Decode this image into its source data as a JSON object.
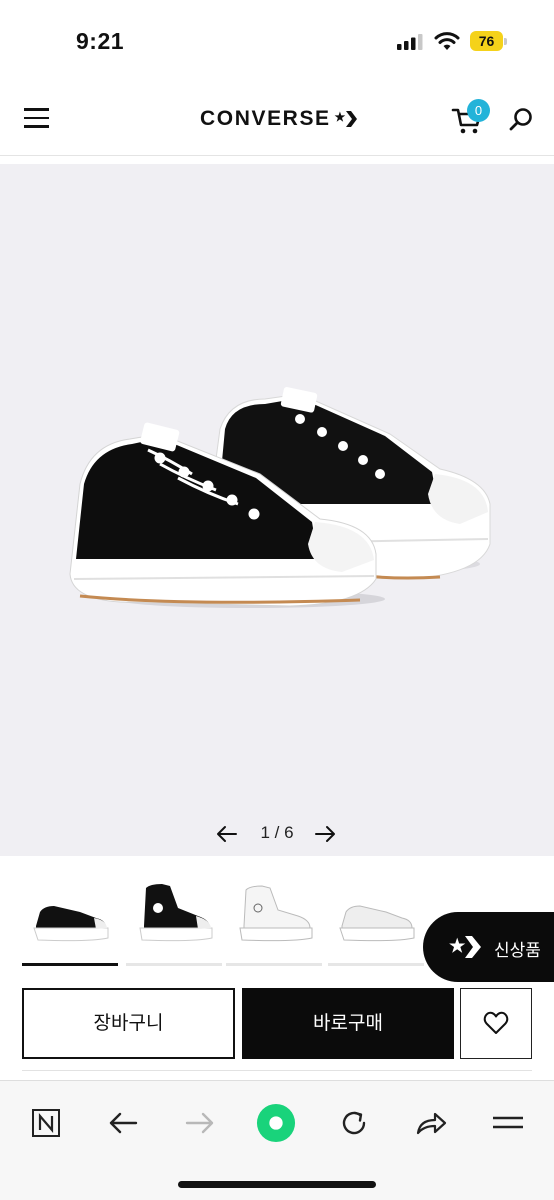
{
  "status_bar": {
    "time": "9:21",
    "battery_level": "76",
    "battery_color": "#f5d21a"
  },
  "header": {
    "brand": "CONVERSE",
    "cart_count": "0",
    "badge_color": "#23b3d9",
    "icons": [
      "menu-icon",
      "converse-star-chevron-icon",
      "cart-icon",
      "search-icon"
    ]
  },
  "gallery": {
    "image_alt": "black low-top platform sneakers",
    "current": "1",
    "separator": "/",
    "total": "6",
    "counter_text": "1 / 6",
    "background": "#f0eff3"
  },
  "thumbnails": [
    {
      "name": "black-low",
      "active": true
    },
    {
      "name": "black-high",
      "active": false
    },
    {
      "name": "white-high",
      "active": false
    },
    {
      "name": "white-low",
      "active": false
    }
  ],
  "fab": {
    "label": "신상품"
  },
  "actions": {
    "cart_label": "장바구니",
    "buy_label": "바로구매"
  },
  "toolbar": {
    "items": [
      "naver-n-icon",
      "back-arrow-icon",
      "forward-arrow-icon",
      "green-dot-icon",
      "refresh-icon",
      "share-icon",
      "menu-lines-icon"
    ],
    "accent": "#19d37b"
  }
}
